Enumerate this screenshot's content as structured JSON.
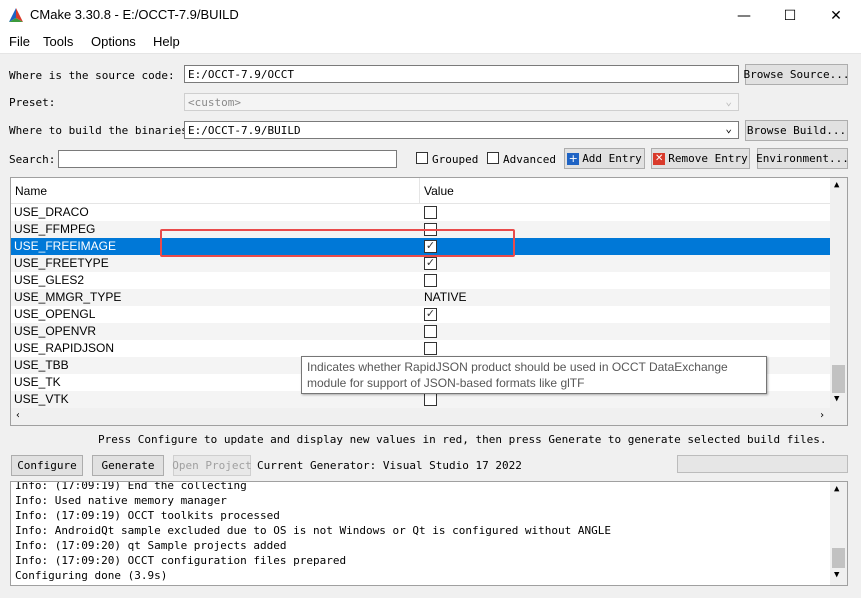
{
  "window": {
    "title": "CMake 3.30.8 - E:/OCCT-7.9/BUILD",
    "minimize_glyph": "—",
    "maximize_glyph": "☐",
    "close_glyph": "✕"
  },
  "menu": [
    "File",
    "Tools",
    "Options",
    "Help"
  ],
  "source": {
    "label": "Where is the source code:",
    "value": "E:/OCCT-7.9/OCCT",
    "button": "Browse Source..."
  },
  "preset": {
    "label": "Preset:",
    "value": "<custom>"
  },
  "build": {
    "label": "Where to build the binaries:",
    "value": "E:/OCCT-7.9/BUILD",
    "button": "Browse Build..."
  },
  "search": {
    "label": "Search:",
    "value": ""
  },
  "options": {
    "grouped": "Grouped",
    "advanced": "Advanced",
    "add_entry": "Add Entry",
    "remove_entry": "Remove Entry",
    "environment": "Environment..."
  },
  "table": {
    "headers": [
      "Name",
      "Value"
    ],
    "rows": [
      {
        "name": "USE_DRACO",
        "checked": false
      },
      {
        "name": "USE_FFMPEG",
        "checked": false
      },
      {
        "name": "USE_FREEIMAGE",
        "checked": true,
        "selected": true
      },
      {
        "name": "USE_FREETYPE",
        "checked": true
      },
      {
        "name": "USE_GLES2",
        "checked": false
      },
      {
        "name": "USE_MMGR_TYPE",
        "text": "NATIVE"
      },
      {
        "name": "USE_OPENGL",
        "checked": true
      },
      {
        "name": "USE_OPENVR",
        "checked": false
      },
      {
        "name": "USE_RAPIDJSON",
        "checked": false
      },
      {
        "name": "USE_TBB",
        "checked": false
      },
      {
        "name": "USE_TK",
        "checked": true
      },
      {
        "name": "USE_VTK",
        "checked": false
      }
    ]
  },
  "tooltip": "Indicates whether RapidJSON product should be used in OCCT DataExchange module for support of JSON-based formats like glTF",
  "hint": "Press Configure to update and display new values in red, then press Generate to generate selected build files.",
  "actions": {
    "configure": "Configure",
    "generate": "Generate",
    "open_project": "Open Project",
    "generator": "Current Generator: Visual Studio 17 2022"
  },
  "log": [
    "Info: (17:09:19) End the collecting",
    "Info: Used native memory manager",
    "Info: (17:09:19) OCCT toolkits processed",
    "Info: AndroidQt sample excluded due to OS is not Windows or Qt is configured without ANGLE",
    "Info: (17:09:20) qt Sample projects added",
    "Info: (17:09:20) OCCT configuration files prepared",
    "Configuring done (3.9s)"
  ],
  "colors": {
    "selection": "#0078d7",
    "highlight_box": "#e94b4b",
    "cmake_red": "#d93a2b",
    "cmake_blue": "#1e63c4",
    "cmake_green": "#3c9a3c"
  },
  "icons": {
    "add": "plus-icon",
    "remove": "x-icon",
    "app": "cmake-logo-icon"
  }
}
